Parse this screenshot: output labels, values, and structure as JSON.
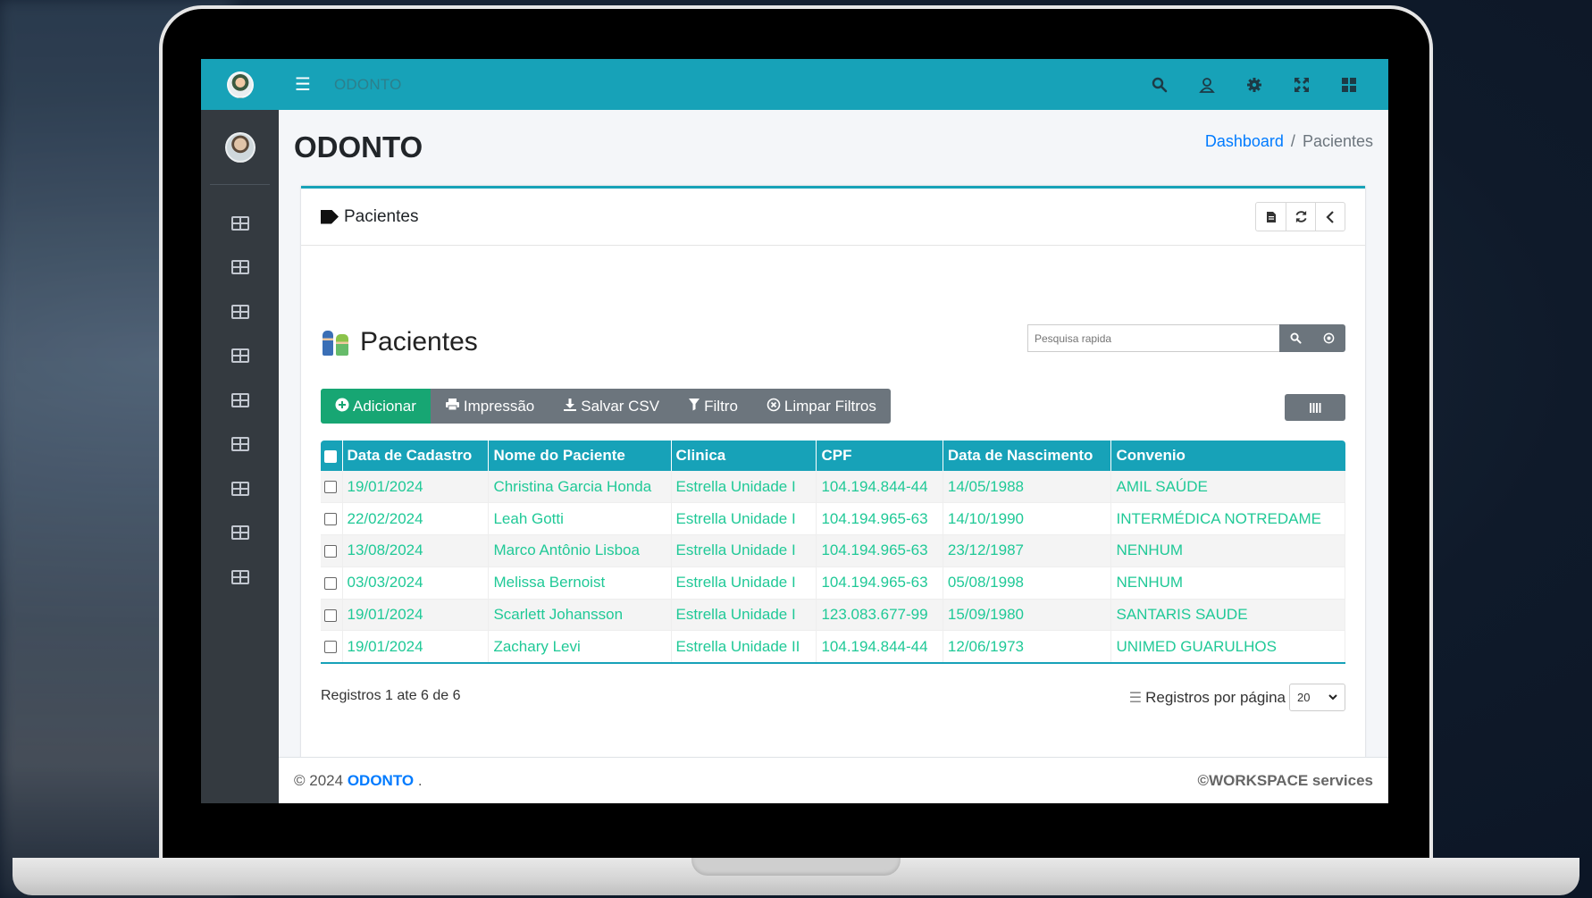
{
  "navbar": {
    "title": "ODONTO",
    "icons": [
      "search-icon",
      "user-icon",
      "gear-icon",
      "expand-icon",
      "apps-icon"
    ]
  },
  "page": {
    "title": "ODONTO",
    "breadcrumb": {
      "home": "Dashboard",
      "separator": "/",
      "current": "Pacientes"
    }
  },
  "card": {
    "header_title": "Pacientes",
    "section_title": "Pacientes",
    "search_placeholder": "Pesquisa rapida",
    "actions": {
      "add": "Adicionar",
      "print": "Impressão",
      "csv": "Salvar CSV",
      "filter": "Filtro",
      "clear": "Limpar Filtros"
    }
  },
  "table": {
    "columns": [
      "Data de Cadastro",
      "Nome do Paciente",
      "Clinica",
      "CPF",
      "Data de Nascimento",
      "Convenio"
    ],
    "rows": [
      [
        "19/01/2024",
        "Christina Garcia Honda",
        "Estrella Unidade I",
        "104.194.844-44",
        "14/05/1988",
        "AMIL SAÚDE"
      ],
      [
        "22/02/2024",
        "Leah Gotti",
        "Estrella Unidade I",
        "104.194.965-63",
        "14/10/1990",
        "INTERMÉDICA NOTREDAME"
      ],
      [
        "13/08/2024",
        "Marco Antônio Lisboa",
        "Estrella Unidade I",
        "104.194.965-63",
        "23/12/1987",
        "NENHUM"
      ],
      [
        "03/03/2024",
        "Melissa Bernoist",
        "Estrella Unidade I",
        "104.194.965-63",
        "05/08/1998",
        "NENHUM"
      ],
      [
        "19/01/2024",
        "Scarlett Johansson",
        "Estrella Unidade I",
        "123.083.677-99",
        "15/09/1980",
        "SANTARIS SAUDE"
      ],
      [
        "19/01/2024",
        "Zachary Levi",
        "Estrella Unidade II",
        "104.194.844-44",
        "12/06/1973",
        "UNIMED GUARULHOS"
      ]
    ]
  },
  "pagination": {
    "records_info": "Registros 1 ate 6 de 6",
    "per_page_label": "Registros por página",
    "per_page_value": "20"
  },
  "footer": {
    "copyright_prefix": "© 2024",
    "brand": "ODONTO",
    "suffix": ".",
    "right": "©WORKSPACE services"
  },
  "colors": {
    "primary": "#17a2b8",
    "success": "#17a673",
    "secondary": "#6c757d",
    "row_text": "#20c997",
    "sidebar": "#343a40"
  }
}
